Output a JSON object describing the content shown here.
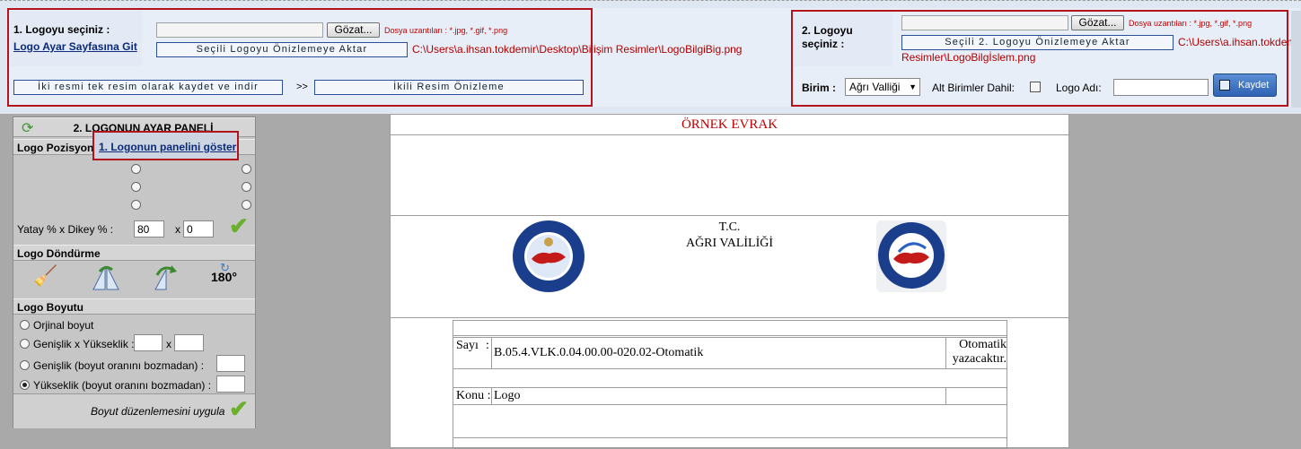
{
  "top": {
    "logo1": {
      "label": "1. Logoyu seçiniz :",
      "settings_link": "Logo Ayar Sayfasına Git",
      "browse": "Gözat...",
      "ext_hint": "Dosya uzantıları : *.jpg, *.gif, *.png",
      "preview_button": "Seçili Logoyu Önizlemeye Aktar",
      "path": "C:\\Users\\a.ihsan.tokdemir\\Desktop\\Bilişim Resimler\\LogoBilgiBig.png",
      "save_combined_button": "İki resmi tek resim olarak kaydet ve indir",
      "arrows": ">>",
      "dual_preview_button": "İkili Resim Önizleme"
    },
    "logo2": {
      "label": "2. Logoyu seçiniz :",
      "browse": "Gözat...",
      "ext_hint": "Dosya uzantıları : *.jpg, *.gif, *.png",
      "preview_button": "Seçili 2. Logoyu Önizlemeye Aktar",
      "path_line1": "C:\\Users\\a.ihsan.tokdemir",
      "path_line2": "Resimler\\LogoBilgİslem.png"
    },
    "birim_label": "Birim :",
    "birim_value": "Ağrı Valliği",
    "alt_birimler_label": "Alt Birimler Dahil:",
    "logo_adi_label": "Logo Adı:",
    "logo_adi_value": "",
    "save_button": "Kaydet"
  },
  "panel": {
    "title": "2. LOGONUN AYAR PANELİ",
    "position_label": "Logo Pozisyonu",
    "show_panel_link": "1. Logonun panelini göster",
    "offset_label": "Yatay % x Dikey % :",
    "horizontal_value": "80",
    "x_sep": "x",
    "vertical_value": "0",
    "rotate_header": "Logo Döndürme",
    "rotate_180": "180°",
    "size_header": "Logo Boyutu",
    "size_options": [
      "Orjinal boyut",
      "Genişlik x Yükseklik :",
      "Genişlik (boyut oranını bozmadan) :",
      "Yükseklik (boyut oranını bozmadan) :"
    ],
    "size_selected": 3,
    "apply_label": "Boyut düzenlemesini uygula"
  },
  "doc": {
    "title": "ÖRNEK EVRAK",
    "tc": "T.C.",
    "valilik": "AĞRI VALİLİĞİ",
    "logo_left_text": "TÜRKİYE CUMHURİYETİ İÇİŞLERİ BAKANLIĞI",
    "logo_right_text": "T.C. İÇİŞLERİ BAKANLIĞI BİLGİ İŞLEM DAİRESİ BAŞKANLIĞI",
    "sayi_label": "Sayı",
    "colon": ":",
    "sayi_value": "B.05.4.VLK.0.04.00.00-020.02-Otomatik",
    "otomatik_line1": "Otomatik",
    "otomatik_line2": "yazacaktır.",
    "konu_label": "Konu :",
    "konu_value": "Logo"
  },
  "colors": {
    "highlight_border": "#b3131a",
    "doc_title": "#c00000",
    "path_red": "#b00000"
  }
}
